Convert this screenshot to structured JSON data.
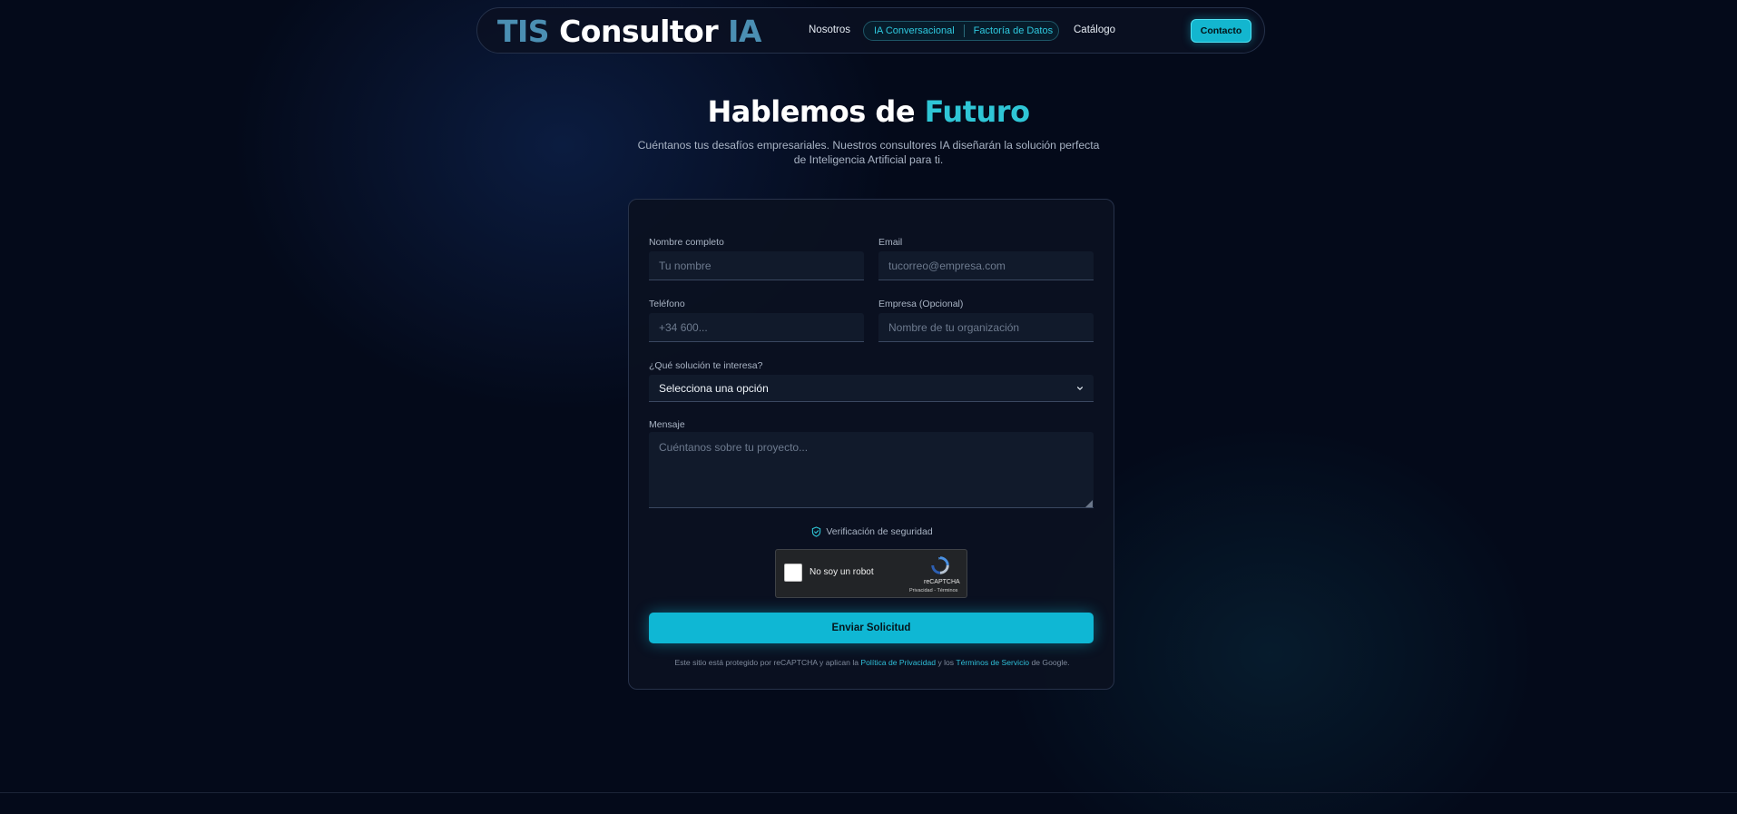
{
  "nav": {
    "logo": {
      "part1": "TIS",
      "part2": "Consultor",
      "part3": "IA"
    },
    "links": {
      "nosotros": "Nosotros",
      "ia_conversacional": "IA Conversacional",
      "factoria": "Factoría de Datos",
      "catalogo": "Catálogo"
    },
    "contact": "Contacto"
  },
  "hero": {
    "title_main": "Hablemos de",
    "title_accent": "Futuro",
    "subtitle": "Cuéntanos tus desafíos empresariales. Nuestros consultores IA diseñarán la solución perfecta de Inteligencia Artificial para ti."
  },
  "form": {
    "name": {
      "label": "Nombre completo",
      "placeholder": "Tu nombre"
    },
    "email": {
      "label": "Email",
      "placeholder": "tucorreo@empresa.com"
    },
    "phone": {
      "label": "Teléfono",
      "placeholder": "+34 600..."
    },
    "company": {
      "label": "Empresa (Opcional)",
      "placeholder": "Nombre de tu organización"
    },
    "solution": {
      "label": "¿Qué solución te interesa?",
      "value": "Selecciona una opción"
    },
    "message": {
      "label": "Mensaje",
      "placeholder": "Cuéntanos sobre tu proyecto..."
    },
    "security": "Verificación de seguridad",
    "recaptcha": {
      "label": "No soy un robot",
      "brand": "reCAPTCHA",
      "links": "Privacidad - Términos"
    },
    "submit": "Enviar Solicitud",
    "legal": {
      "pre": "Este sitio está protegido por reCAPTCHA y aplican la",
      "privacy": "Política de Privacidad",
      "mid": "y los",
      "terms": "Términos de Servicio",
      "post": "de Google."
    }
  },
  "colors": {
    "accent": "#13b6cf",
    "background": "#040a1a",
    "logo_accent": "#4b8fb3"
  },
  "icons": {
    "security": "shield-check-icon",
    "select": "chevron-down-icon",
    "recaptcha": "recaptcha-logo-icon"
  }
}
